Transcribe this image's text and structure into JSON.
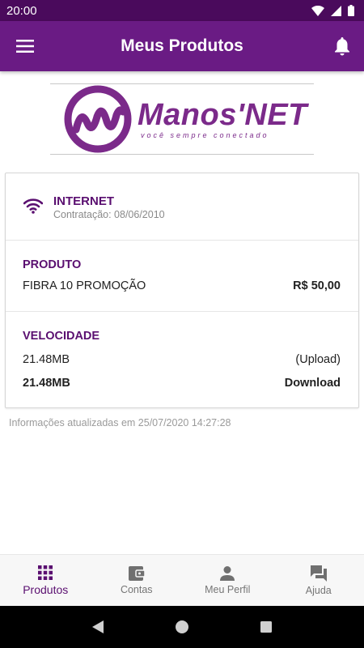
{
  "status_bar": {
    "time": "20:00"
  },
  "app_bar": {
    "title": "Meus Produtos",
    "menu_icon": "hamburger-menu-icon",
    "bell_icon": "bell-icon",
    "color": "#6a1b84"
  },
  "logo": {
    "name": "Manos'NET",
    "tagline": "você sempre conectado",
    "color": "#7b2a8a"
  },
  "service": {
    "icon": "wifi-icon",
    "name": "INTERNET",
    "contract_date": "Contratação: 08/06/2010"
  },
  "produto": {
    "title": "PRODUTO",
    "plan": "FIBRA 10 PROMOÇÃO",
    "price": "R$ 50,00"
  },
  "velocidade": {
    "title": "VELOCIDADE",
    "upload_value": "21.48MB",
    "upload_label": "(Upload)",
    "download_value": "21.48MB",
    "download_label": "Download"
  },
  "updated_text": "Informações atualizadas em 25/07/2020 14:27:28",
  "bottom_nav": {
    "items": [
      {
        "label": "Produtos",
        "icon": "grid-icon",
        "active": true
      },
      {
        "label": "Contas",
        "icon": "wallet-icon",
        "active": false
      },
      {
        "label": "Meu Perfil",
        "icon": "person-icon",
        "active": false
      },
      {
        "label": "Ajuda",
        "icon": "chat-icon",
        "active": false
      }
    ],
    "active_color": "#5a0f70"
  }
}
